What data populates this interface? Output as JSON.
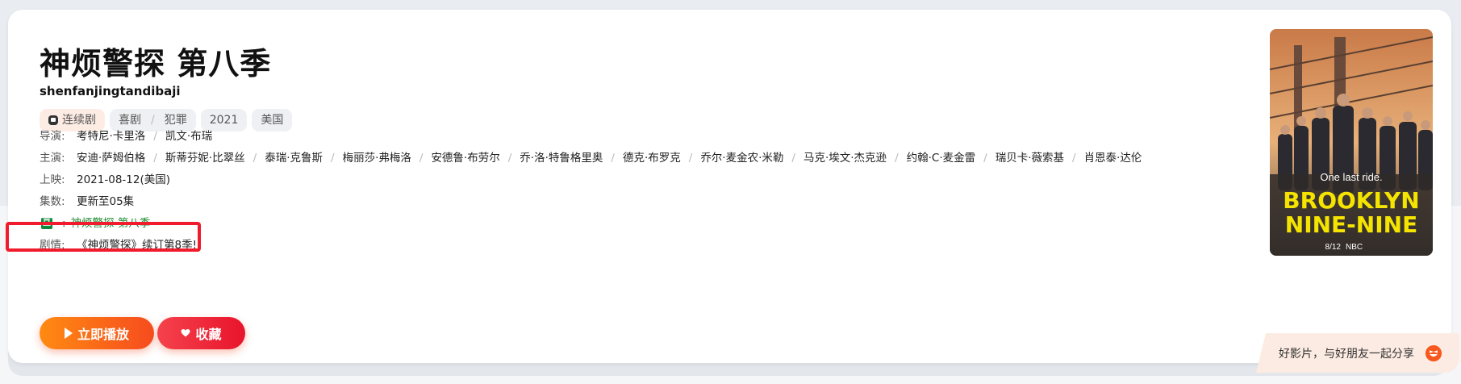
{
  "title": "神烦警探 第八季",
  "subtitle": "shenfanjingtandibaji",
  "tags": {
    "series": "连续剧",
    "genres": [
      "喜剧",
      "犯罪"
    ],
    "year": "2021",
    "region": "美国"
  },
  "director": {
    "label": "导演:",
    "names": [
      "考特尼·卡里洛",
      "凯文·布瑞"
    ]
  },
  "cast": {
    "label": "主演:",
    "names": [
      "安迪·萨姆伯格",
      "斯蒂芬妮·比翠丝",
      "泰瑞·克鲁斯",
      "梅丽莎·弗梅洛",
      "安德鲁·布劳尔",
      "乔·洛·特鲁格里奥",
      "德克·布罗克",
      "乔尔·麦金农·米勒",
      "马克·埃文·杰克逊",
      "约翰·C·麦金雷",
      "瑞贝卡·薇索基",
      "肖恩泰·达伦"
    ]
  },
  "release": {
    "label": "上映:",
    "value": "2021-08-12(美国)"
  },
  "episodes": {
    "label": "集数:",
    "value": "更新至05集"
  },
  "douban": {
    "icon": "douban-icon",
    "colon": ":",
    "link": "神烦警探 第八季"
  },
  "plot": {
    "label": "剧情:",
    "value": "《神烦警探》续订第8季!"
  },
  "actions": {
    "play": "立即播放",
    "favorite": "收藏"
  },
  "poster": {
    "tagline": "One last ride.",
    "line1": "BROOKLYN",
    "line2": "NINE-NINE",
    "date": "8/12",
    "network": "NBC"
  },
  "share": {
    "text": "好影片，与好朋友一起分享"
  },
  "colors": {
    "accent_orange": "#ff8a12",
    "accent_red": "#e8142c",
    "douban_green": "#0f8a3c",
    "highlight_red": "#f01b2c"
  }
}
